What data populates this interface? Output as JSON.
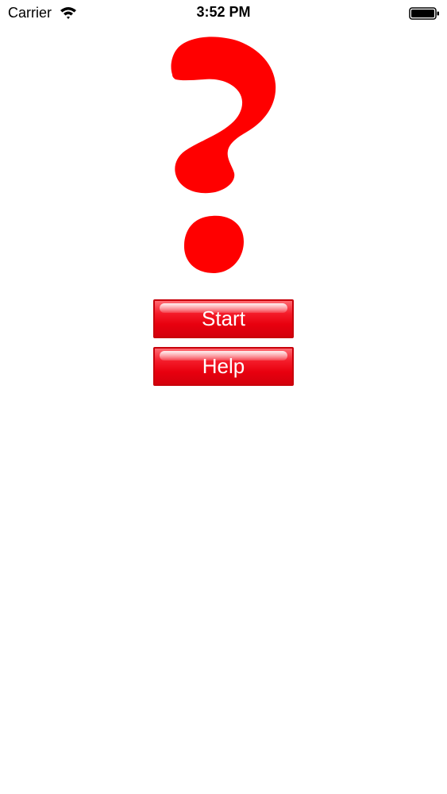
{
  "status_bar": {
    "carrier": "Carrier",
    "time": "3:52 PM"
  },
  "hero": {
    "icon": "question-mark-icon",
    "color": "#ff0000"
  },
  "menu": {
    "start_label": "Start",
    "help_label": "Help",
    "button_color": "#e8000f"
  }
}
